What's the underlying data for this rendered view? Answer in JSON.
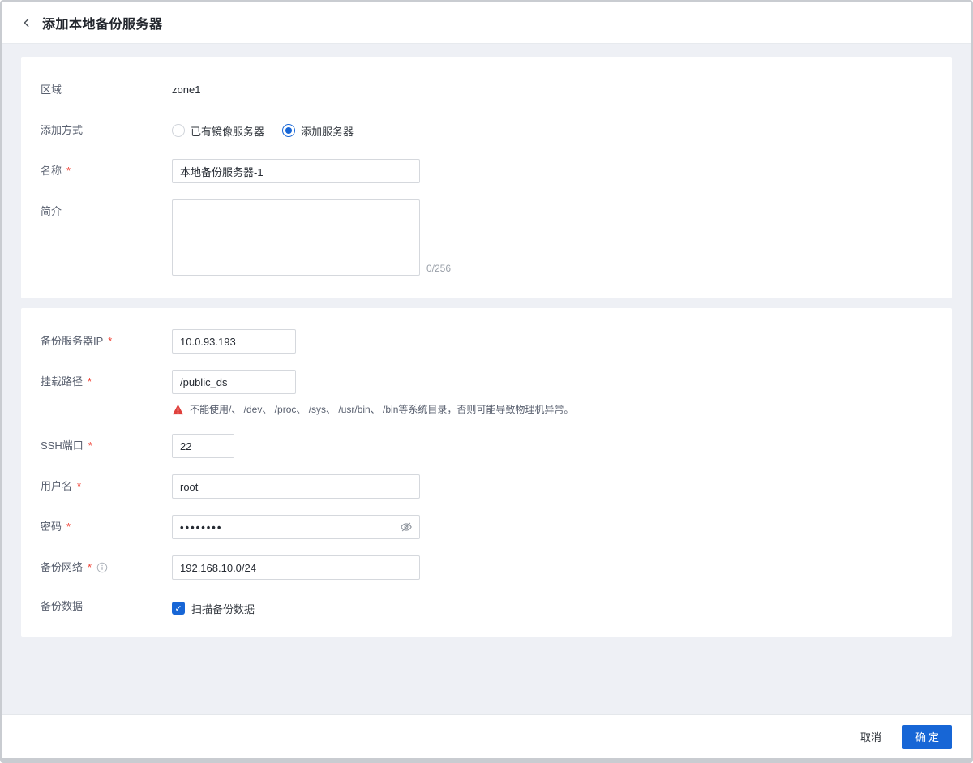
{
  "colors": {
    "accent": "#1766d6",
    "danger": "#e0403c"
  },
  "required_mark": "*",
  "header": {
    "title": "添加本地备份服务器"
  },
  "form1": {
    "zone": {
      "label": "区域",
      "value": "zone1"
    },
    "add_mode": {
      "label": "添加方式",
      "options": [
        {
          "label": "已有镜像服务器",
          "selected": false
        },
        {
          "label": "添加服务器",
          "selected": true
        }
      ]
    },
    "name": {
      "label": "名称",
      "value": "本地备份服务器-1"
    },
    "description": {
      "label": "简介",
      "value": "",
      "counter": "0/256"
    }
  },
  "form2": {
    "ip": {
      "label": "备份服务器IP",
      "value": "10.0.93.193"
    },
    "mount_path": {
      "label": "挂载路径",
      "value": "/public_ds",
      "warning": "不能使用/、 /dev、 /proc、 /sys、 /usr/bin、 /bin等系统目录，否则可能导致物理机异常。"
    },
    "ssh_port": {
      "label": "SSH端口",
      "value": "22"
    },
    "username": {
      "label": "用户名",
      "value": "root"
    },
    "password": {
      "label": "密码",
      "value": "••••••••"
    },
    "backup_network": {
      "label": "备份网络",
      "value": "192.168.10.0/24"
    },
    "backup_data": {
      "label": "备份数据",
      "checkbox_label": "扫描备份数据",
      "checked": true
    }
  },
  "footer": {
    "cancel": "取消",
    "confirm": "确定"
  }
}
